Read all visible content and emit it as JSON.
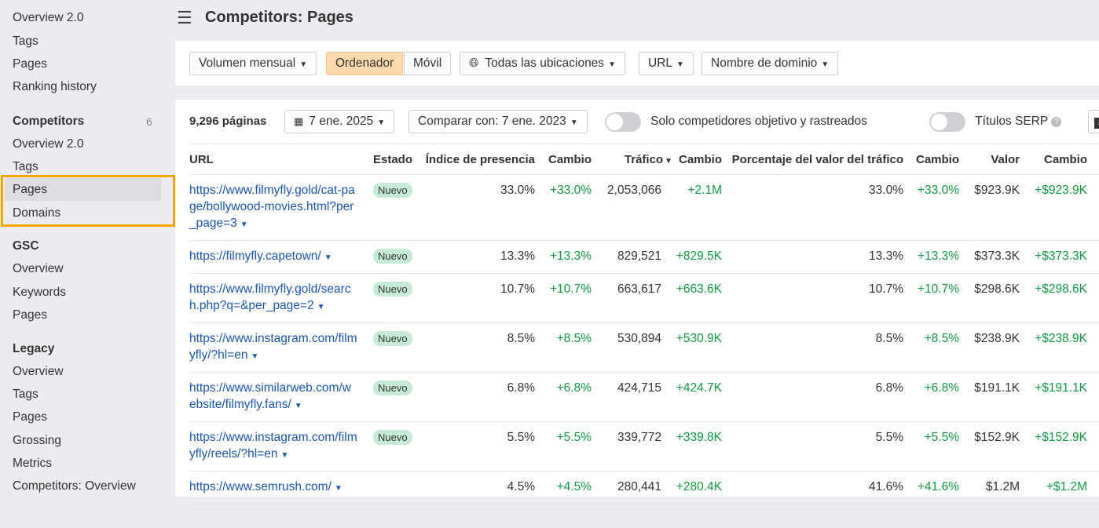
{
  "sidebar": {
    "top_items": [
      "Overview 2.0",
      "Tags",
      "Pages",
      "Ranking history"
    ],
    "competitors": {
      "title": "Competitors",
      "count": "6",
      "items": [
        "Overview 2.0",
        "Tags",
        "Pages",
        "Domains"
      ]
    },
    "gsc": {
      "title": "GSC",
      "items": [
        "Overview",
        "Keywords",
        "Pages"
      ]
    },
    "legacy": {
      "title": "Legacy",
      "items": [
        "Overview",
        "Tags",
        "Pages",
        "Grossing",
        "Metrics",
        "Competitors: Overview"
      ]
    }
  },
  "header": {
    "title": "Competitors: Pages"
  },
  "filters": {
    "volume": "Volumen mensual",
    "desktop": "Ordenador",
    "mobile": "Móvil",
    "locations": "Todas las ubicaciones",
    "url": "URL",
    "domain": "Nombre de dominio"
  },
  "toolbar": {
    "count": "9,296 páginas",
    "date": "7 ene. 2025",
    "compare": "Comparar con: 7 ene. 2023",
    "toggle1": "Solo competidores objetivo y rastreados",
    "toggle2": "Títulos SERP"
  },
  "table": {
    "headers": [
      "URL",
      "Estado",
      "Índice de presencia",
      "Cambio",
      "Tráfico",
      "Cambio",
      "Porcentaje del valor del tráfico",
      "Cambio",
      "Valor",
      "Cambio"
    ],
    "rows": [
      {
        "url": "https://www.filmyfly.gold/cat-page/bollywood-movies.html?per_page=3",
        "estado": "Nuevo",
        "indice": "33.0%",
        "c1": "+33.0%",
        "trafico": "2,053,066",
        "c2": "+2.1M",
        "pct": "33.0%",
        "c3": "+33.0%",
        "valor": "$923.9K",
        "c4": "+$923.9K"
      },
      {
        "url": "https://filmyfly.capetown/",
        "estado": "Nuevo",
        "indice": "13.3%",
        "c1": "+13.3%",
        "trafico": "829,521",
        "c2": "+829.5K",
        "pct": "13.3%",
        "c3": "+13.3%",
        "valor": "$373.3K",
        "c4": "+$373.3K"
      },
      {
        "url": "https://www.filmyfly.gold/search.php?q=&per_page=2",
        "estado": "Nuevo",
        "indice": "10.7%",
        "c1": "+10.7%",
        "trafico": "663,617",
        "c2": "+663.6K",
        "pct": "10.7%",
        "c3": "+10.7%",
        "valor": "$298.6K",
        "c4": "+$298.6K"
      },
      {
        "url": "https://www.instagram.com/filmyfly/?hl=en",
        "estado": "Nuevo",
        "indice": "8.5%",
        "c1": "+8.5%",
        "trafico": "530,894",
        "c2": "+530.9K",
        "pct": "8.5%",
        "c3": "+8.5%",
        "valor": "$238.9K",
        "c4": "+$238.9K"
      },
      {
        "url": "https://www.similarweb.com/website/filmyfly.fans/",
        "estado": "Nuevo",
        "indice": "6.8%",
        "c1": "+6.8%",
        "trafico": "424,715",
        "c2": "+424.7K",
        "pct": "6.8%",
        "c3": "+6.8%",
        "valor": "$191.1K",
        "c4": "+$191.1K"
      },
      {
        "url": "https://www.instagram.com/filmyfly/reels/?hl=en",
        "estado": "Nuevo",
        "indice": "5.5%",
        "c1": "+5.5%",
        "trafico": "339,772",
        "c2": "+339.8K",
        "pct": "5.5%",
        "c3": "+5.5%",
        "valor": "$152.9K",
        "c4": "+$152.9K"
      },
      {
        "url": "https://www.semrush.com/",
        "estado": "",
        "indice": "4.5%",
        "c1": "+4.5%",
        "trafico": "280,441",
        "c2": "+280.4K",
        "pct": "41.6%",
        "c3": "+41.6%",
        "valor": "$1.2M",
        "c4": "+$1.2M"
      }
    ]
  }
}
